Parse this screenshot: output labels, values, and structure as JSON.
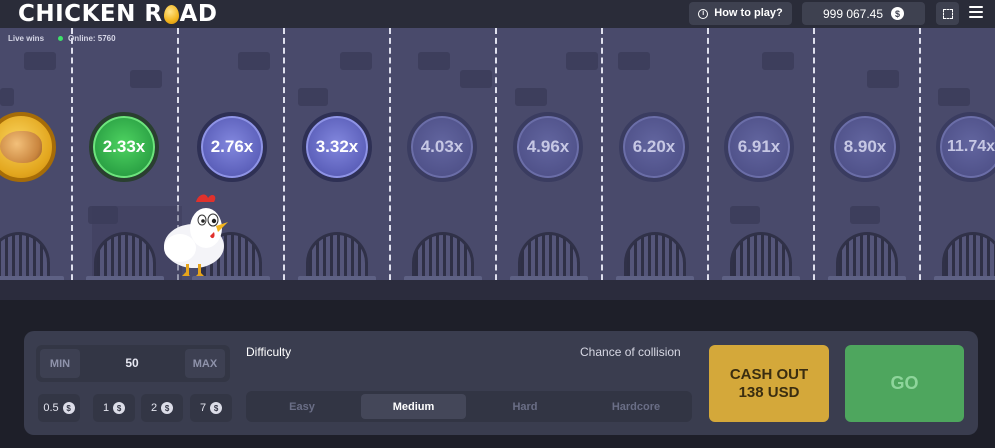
{
  "header": {
    "logo_left": "CHICKEN R",
    "logo_right": "AD",
    "how_to_play": "How to play?",
    "balance": "999 067.45",
    "currency_icon": "$"
  },
  "game": {
    "live_wins": "Live wins",
    "online": "Online: 5760",
    "multipliers": [
      "2.33x",
      "2.76x",
      "3.32x",
      "4.03x",
      "4.96x",
      "6.20x",
      "6.91x",
      "8.90x",
      "11.74x"
    ]
  },
  "controls": {
    "min_label": "MIN",
    "max_label": "MAX",
    "bet_value": "50",
    "quick_bets": [
      "0.5",
      "1",
      "2",
      "7"
    ],
    "difficulty_label": "Difficulty",
    "collision_label": "Chance of collision",
    "difficulties": [
      "Easy",
      "Medium",
      "Hard",
      "Hardcore"
    ],
    "selected_difficulty": "Medium",
    "cashout_line1": "CASH OUT",
    "cashout_line2": "138 USD",
    "go_label": "GO"
  },
  "colors": {
    "current_multiplier": "#2ea647",
    "cashout": "#d4a83a",
    "go": "#4ea65e"
  }
}
